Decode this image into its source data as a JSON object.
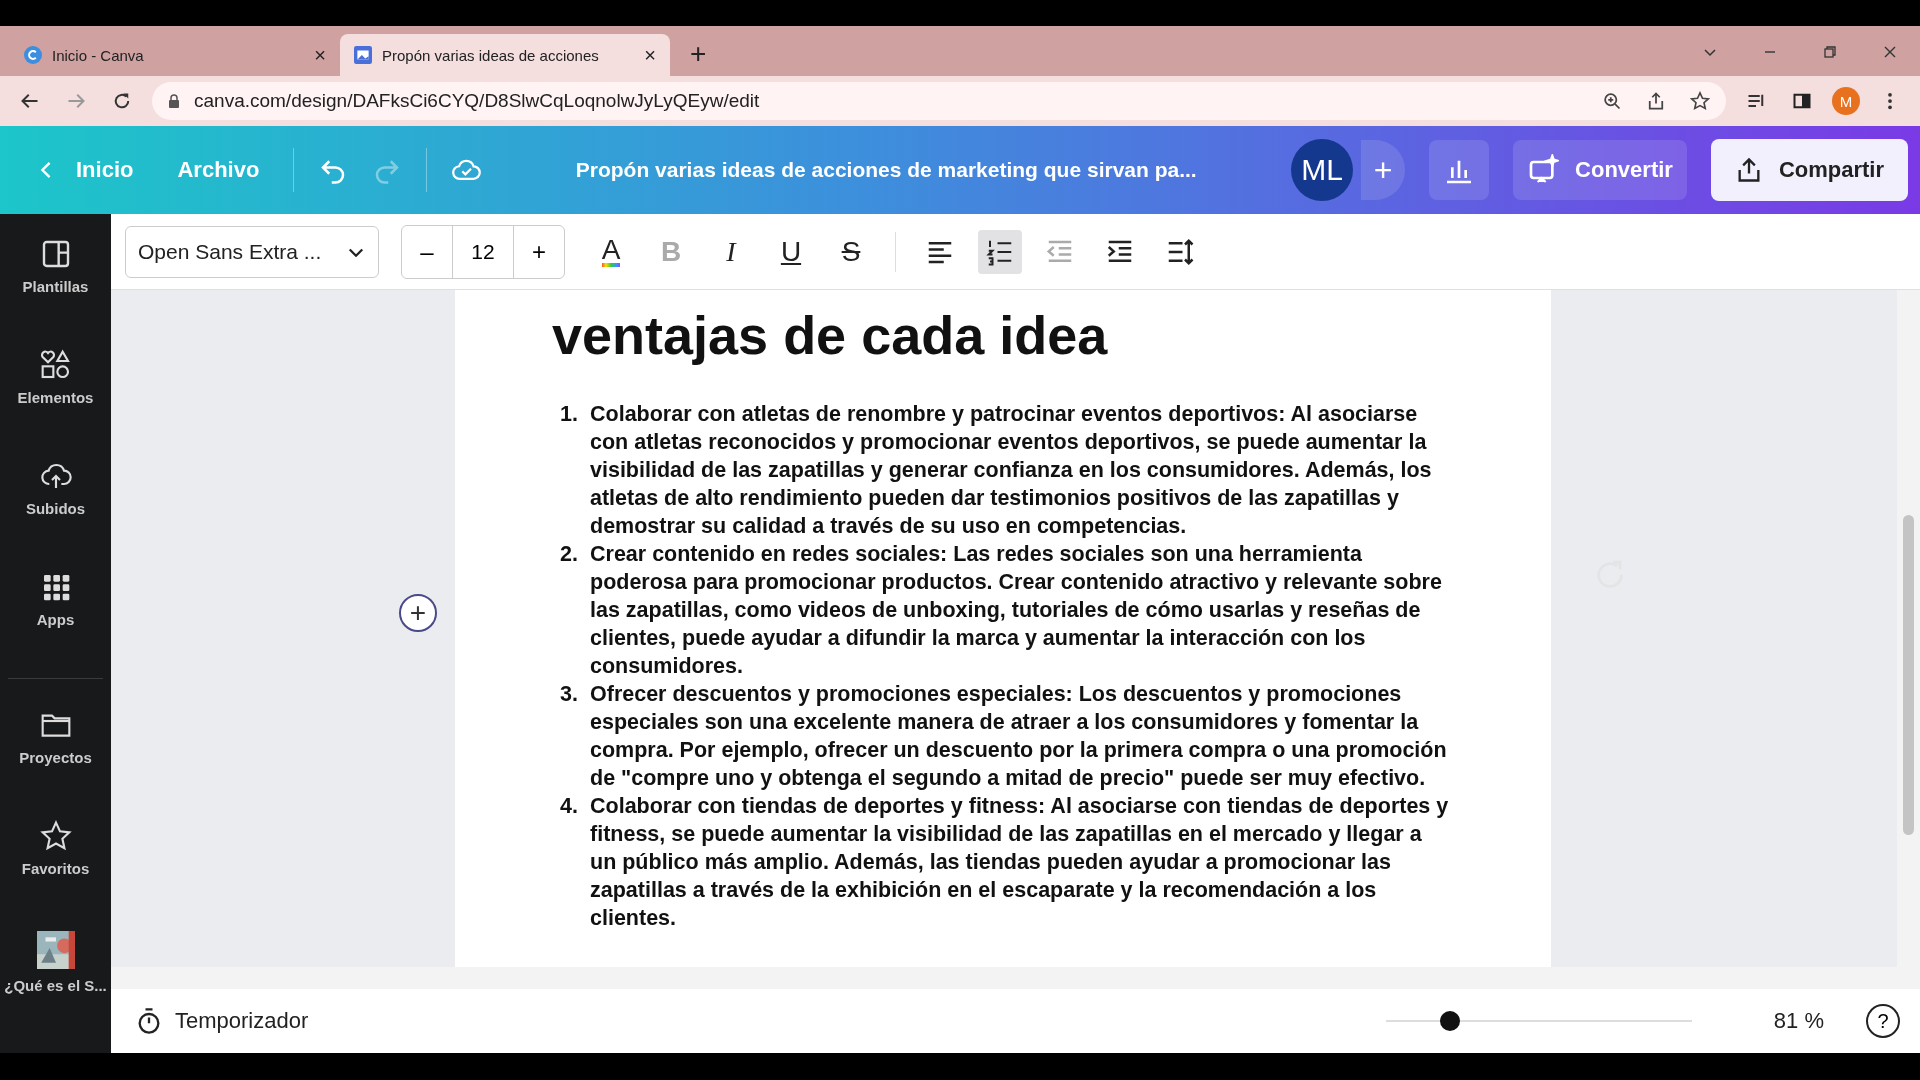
{
  "browser": {
    "tabs": [
      {
        "title": "Inicio - Canva",
        "selected": false,
        "close": "×"
      },
      {
        "title": "Propón varias ideas de acciones",
        "selected": true,
        "close": "×"
      }
    ],
    "new_tab": "+",
    "url": "canva.com/design/DAFksCi6CYQ/D8SlwCqLoqnolwJyLyQEyw/edit",
    "profile": "M"
  },
  "header": {
    "back": "Inicio",
    "menu": "Archivo",
    "redo_disabled": true,
    "title": "Propón varias ideas de acciones de marketing que sirvan pa...",
    "avatar": "ML",
    "add": "+",
    "convert": "Convertir",
    "share": "Compartir"
  },
  "toolbar": {
    "font": "Open Sans Extra ...",
    "minus": "–",
    "size": "12",
    "plus": "+",
    "tools": [
      {
        "kind": "color",
        "label": "A",
        "selected": false,
        "disabled": false
      },
      {
        "kind": "bold",
        "label": "B",
        "selected": false,
        "disabled": true
      },
      {
        "kind": "italic",
        "label": "I",
        "selected": false,
        "disabled": false
      },
      {
        "kind": "underline",
        "label": "U",
        "selected": false,
        "disabled": false
      },
      {
        "kind": "strike",
        "label": "S",
        "selected": false,
        "disabled": false
      },
      {
        "kind": "align",
        "selected": false,
        "disabled": false
      },
      {
        "kind": "numbered",
        "selected": true,
        "disabled": false
      },
      {
        "kind": "outdent",
        "selected": false,
        "disabled": true
      },
      {
        "kind": "indent",
        "selected": false,
        "disabled": false
      },
      {
        "kind": "spacing",
        "selected": false,
        "disabled": false
      }
    ]
  },
  "sidebar": {
    "items": [
      {
        "kind": "templates",
        "label": "Plantillas"
      },
      {
        "kind": "elements",
        "label": "Elementos"
      },
      {
        "kind": "uploads",
        "label": "Subidos"
      },
      {
        "kind": "apps",
        "label": "Apps"
      },
      {
        "kind": "projects",
        "label": "Proyectos"
      },
      {
        "kind": "favorites",
        "label": "Favoritos"
      },
      {
        "kind": "picture",
        "label": "¿Qué es el S..."
      }
    ]
  },
  "document": {
    "add_block": "+",
    "heading": "ventajas de cada idea",
    "items": [
      {
        "number": "1.",
        "text": "Colaborar con atletas de renombre y patrocinar eventos deportivos: Al asociarse con atletas reconocidos y promocionar eventos deportivos, se puede aumentar la visibilidad de las zapatillas y generar confianza en los consumidores. Además, los atletas de alto rendimiento pueden dar testimonios positivos de las zapatillas y demostrar su calidad a través de su uso en competencias."
      },
      {
        "number": "2.",
        "text": "Crear contenido en redes sociales: Las redes sociales son una herramienta poderosa para promocionar productos. Crear contenido atractivo y relevante sobre las zapatillas, como videos de unboxing, tutoriales de cómo usarlas y reseñas de clientes, puede ayudar a difundir la marca y aumentar la interacción con los consumidores."
      },
      {
        "number": "3.",
        "text": "Ofrecer descuentos y promociones especiales: Los descuentos y promociones especiales son una excelente manera de atraer a los consumidores y fomentar la compra. Por ejemplo, ofrecer un descuento por la primera compra o una promoción de \"compre uno y obtenga el segundo a mitad de precio\" puede ser muy efectivo."
      },
      {
        "number": "4.",
        "text": "Colaborar con tiendas de deportes y fitness: Al asociarse con tiendas de deportes y fitness, se puede aumentar la visibilidad de las zapatillas en el mercado y llegar a un público más amplio. Además, las tiendas pueden ayudar a promocionar las zapatillas a través de la exhibición en el escaparate y la recomendación a los clientes."
      }
    ]
  },
  "footer": {
    "timer": "Temporizador",
    "zoom": {
      "level": 0.21
    },
    "zoom_text": "81 %",
    "help": "?"
  }
}
